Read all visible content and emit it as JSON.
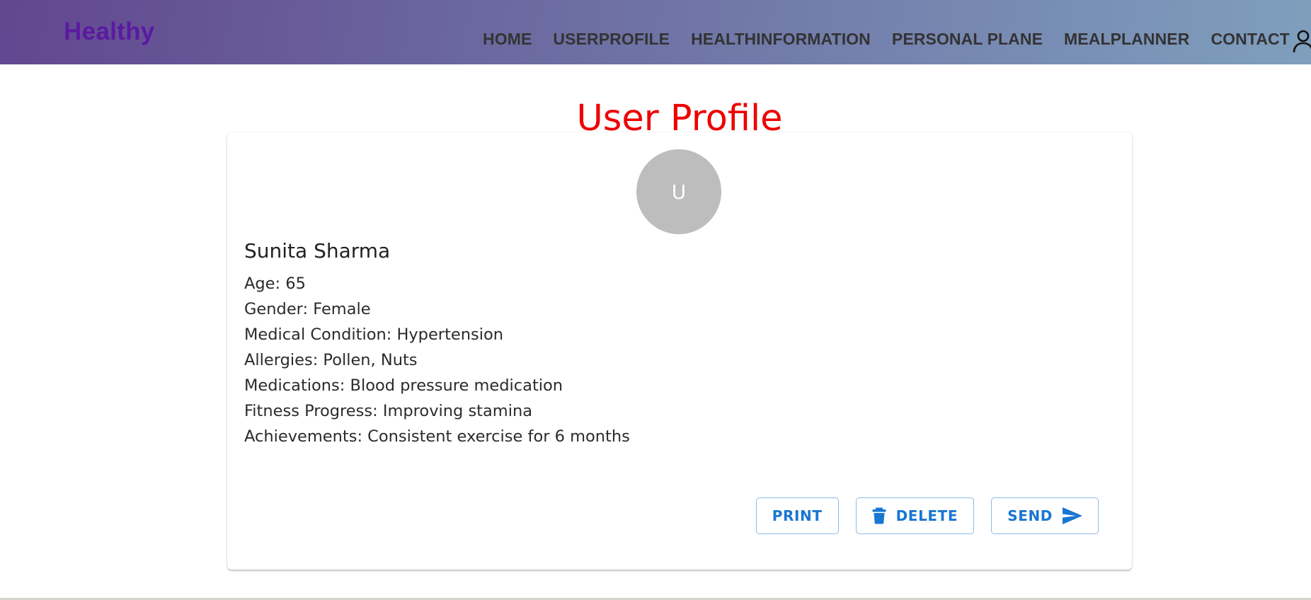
{
  "navbar": {
    "brand": "Healthy",
    "links": [
      {
        "label": "HOME"
      },
      {
        "label": "USERPROFILE"
      },
      {
        "label": "HEALTHINFORMATION"
      },
      {
        "label": "PERSONAL PLANE"
      },
      {
        "label": "MEALPLANNER"
      },
      {
        "label": "CONTACT"
      }
    ],
    "user_icon": "person-outline-icon"
  },
  "page": {
    "title": "User Profile"
  },
  "profile": {
    "avatar_letter": "U",
    "name": "Sunita Sharma",
    "details": [
      "Age: 65",
      "Gender: Female",
      "Medical Condition: Hypertension",
      "Allergies: Pollen, Nuts",
      "Medications: Blood pressure medication",
      "Fitness Progress: Improving stamina",
      "Achievements: Consistent exercise for 6 months"
    ]
  },
  "actions": {
    "print_label": "PRINT",
    "delete_label": "DELETE",
    "delete_icon": "trash-icon",
    "send_label": "SEND",
    "send_icon": "send-arrow-icon"
  },
  "colors": {
    "brand": "#5a1aa0",
    "title": "#ee0000",
    "button_accent": "#1976d2",
    "avatar_bg": "#bdbdbd"
  }
}
